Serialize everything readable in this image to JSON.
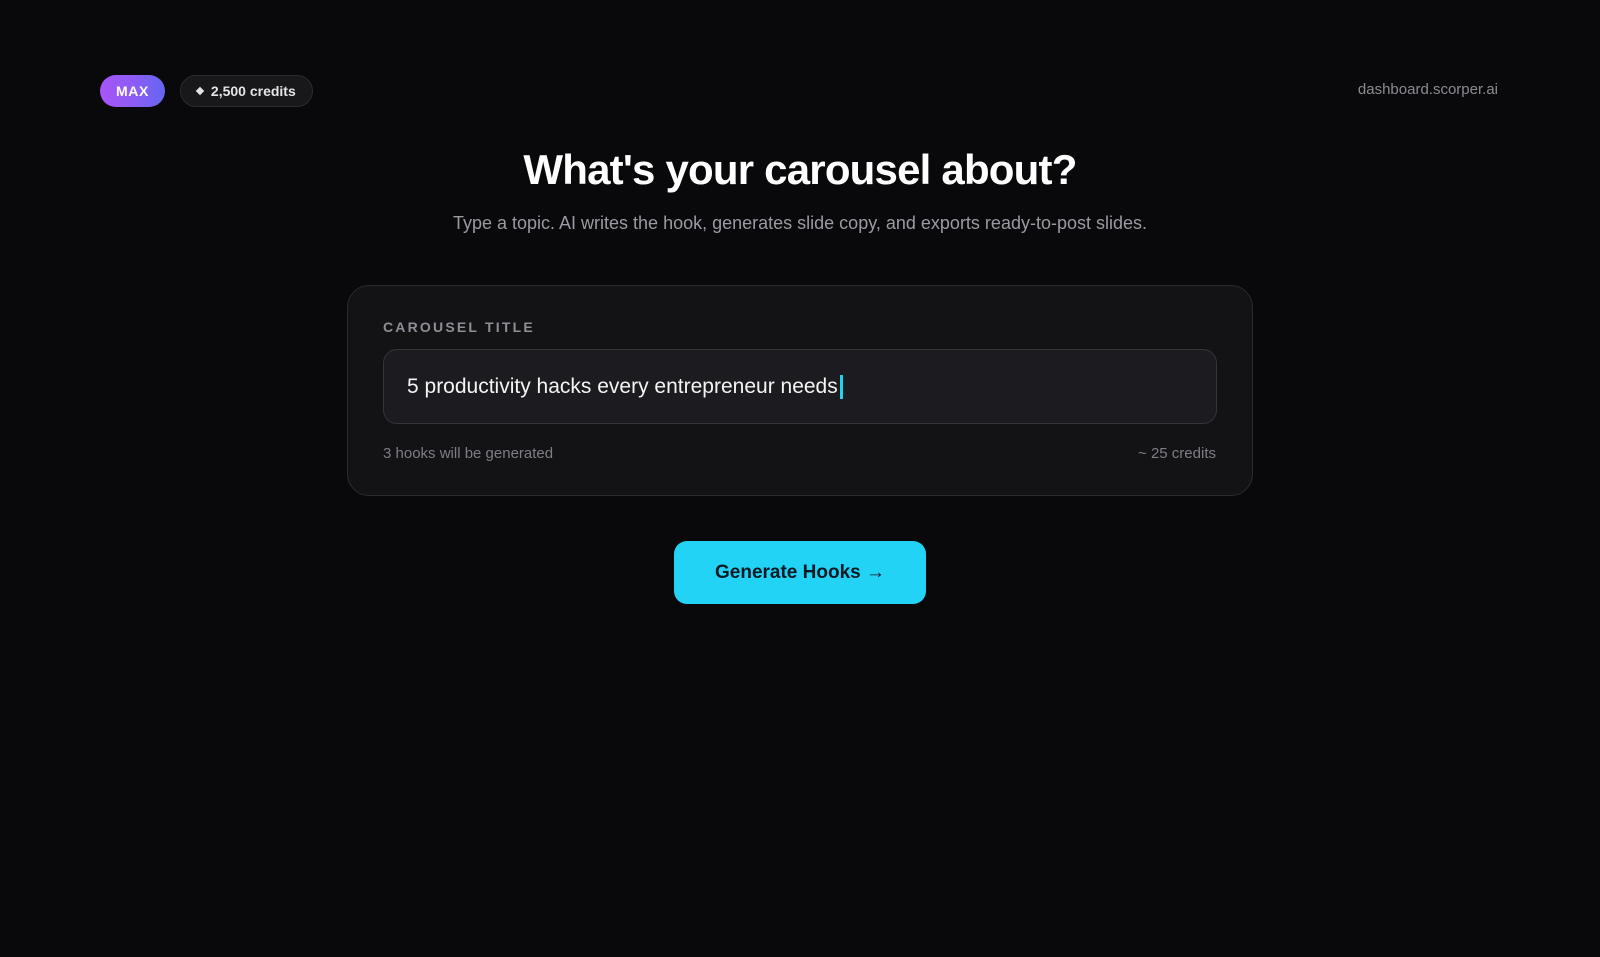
{
  "header": {
    "plan_badge": "MAX",
    "credits_balance": "2,500 credits",
    "domain": "dashboard.scorper.ai"
  },
  "hero": {
    "title": "What's your carousel about?",
    "subtitle": "Type a topic. AI writes the hook, generates slide copy, and exports ready-to-post slides."
  },
  "form": {
    "label": "CAROUSEL TITLE",
    "value": "5 productivity hacks every entrepreneur needs",
    "hooks_note": "3 hooks will be generated",
    "cost_note": "~ 25 credits"
  },
  "actions": {
    "generate_label": "Generate Hooks →"
  },
  "colors": {
    "background": "#09090b",
    "card": "#131316",
    "accent_cyan": "#22d3f5",
    "plan_purple": "#8b5cf6"
  },
  "icons": {
    "credits": "diamond-icon"
  }
}
